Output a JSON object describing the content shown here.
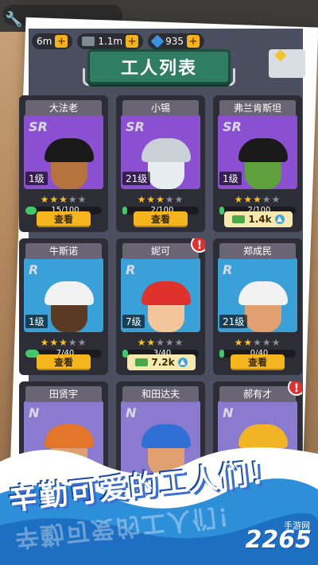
{
  "resources": [
    {
      "name": "cash",
      "value": "6m"
    },
    {
      "name": "bricks",
      "value": "1.1m"
    },
    {
      "name": "gems",
      "value": "935"
    }
  ],
  "title": "工人列表",
  "action_label": "查看",
  "workers": [
    {
      "name": "大法老",
      "rarity": "SR",
      "level": "1级",
      "stars_on": 3,
      "stars_total": 5,
      "progress_text": "15/100",
      "progress": 0.15,
      "footer": "button",
      "art": "pharaoh"
    },
    {
      "name": "小锡",
      "rarity": "SR",
      "level": "21级",
      "stars_on": 3,
      "stars_total": 5,
      "progress_text": "2/100",
      "progress": 0.02,
      "footer": "button",
      "art": "skeleton"
    },
    {
      "name": "弗兰肯斯坦",
      "rarity": "SR",
      "level": "1级",
      "stars_on": 3,
      "stars_total": 5,
      "progress_text": "2/100",
      "progress": 0.02,
      "footer": "money",
      "money": "1.4k",
      "art": "frankenstein"
    },
    {
      "name": "牛斯诺",
      "rarity": "R",
      "level": "1级",
      "stars_on": 3,
      "stars_total": 5,
      "progress_text": "7/40",
      "progress": 0.175,
      "footer": "button",
      "art": "worker-dark"
    },
    {
      "name": "妮可",
      "rarity": "R",
      "level": "7级",
      "stars_on": 2,
      "stars_total": 5,
      "progress_text": "3/40",
      "progress": 0.075,
      "footer": "money",
      "money": "7.2k",
      "alert": "!",
      "art": "girl"
    },
    {
      "name": "郑成民",
      "rarity": "R",
      "level": "21级",
      "stars_on": 2,
      "stars_total": 5,
      "progress_text": "0/40",
      "progress": 0.0,
      "footer": "button",
      "art": "worker-light"
    },
    {
      "name": "田贤宇",
      "rarity": "N",
      "level": "",
      "stars_on": 0,
      "stars_total": 0,
      "progress_text": "",
      "progress": 0,
      "footer": "none",
      "art": "welder"
    },
    {
      "name": "和田达夫",
      "rarity": "N",
      "level": "",
      "stars_on": 0,
      "stars_total": 0,
      "progress_text": "",
      "progress": 0,
      "footer": "none",
      "art": "blue-helmet"
    },
    {
      "name": "郝有才",
      "rarity": "N",
      "level": "",
      "stars_on": 0,
      "stars_total": 0,
      "progress_text": "",
      "progress": 0,
      "footer": "none",
      "alert": "!",
      "art": "yellow-helmet"
    }
  ],
  "slogan": "辛勤可爱的工人们！",
  "brand": {
    "logo": "2265",
    "sub": "手游网"
  },
  "colors": {
    "sr_bg": "#8b4fd1",
    "r_bg": "#3aa0d8",
    "n_bg": "#8a7bd1",
    "accent": "#f4b51f"
  }
}
